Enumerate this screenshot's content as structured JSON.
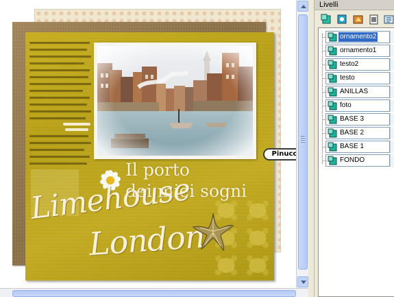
{
  "canvas": {
    "title_line1": "Il porto",
    "title_line2": "dei miei sogni",
    "script_word1": "Limehouse",
    "script_word2": "London",
    "tag_label": "Pinuccia",
    "photo_subject": "harbor-painting",
    "accent_color": "#c3ab1f"
  },
  "layers_panel": {
    "title": "Livelli",
    "toolbar_icons": [
      "new-layer-icon",
      "duplicate-layer-icon",
      "layer-properties-icon",
      "mask-icon",
      "merge-icon"
    ],
    "layers": [
      {
        "name": "ornamento2",
        "selected": true
      },
      {
        "name": "ornamento1",
        "selected": false
      },
      {
        "name": "testo2",
        "selected": false
      },
      {
        "name": "testo",
        "selected": false
      },
      {
        "name": "ANILLAS",
        "selected": false
      },
      {
        "name": "foto",
        "selected": false
      },
      {
        "name": "BASE 3",
        "selected": false
      },
      {
        "name": "BASE 2",
        "selected": false
      },
      {
        "name": "BASE 1",
        "selected": false
      },
      {
        "name": "FONDO",
        "selected": false
      }
    ]
  }
}
